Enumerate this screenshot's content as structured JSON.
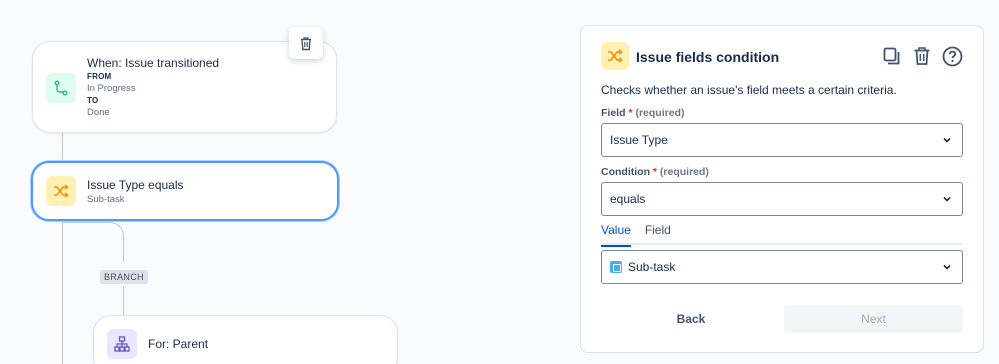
{
  "flow": {
    "trigger": {
      "title": "When: Issue transitioned",
      "from_label": "FROM",
      "from_value": "In Progress",
      "to_label": "TO",
      "to_value": "Done"
    },
    "condition": {
      "title": "Issue Type equals",
      "subtitle": "Sub-task"
    },
    "branch_label": "BRANCH",
    "branch_node": {
      "title": "For: Parent"
    }
  },
  "panel": {
    "title": "Issue fields condition",
    "description": "Checks whether an issue's field meets a certain criteria.",
    "field": {
      "label": "Field",
      "required_mark": "*",
      "required_text": "(required)",
      "value": "Issue Type"
    },
    "condition": {
      "label": "Condition",
      "required_mark": "*",
      "required_text": "(required)",
      "value": "equals"
    },
    "tabs": [
      {
        "label": "Value",
        "active": true
      },
      {
        "label": "Field",
        "active": false
      }
    ],
    "value_select": {
      "value": "Sub-task"
    },
    "buttons": {
      "back": "Back",
      "next": "Next"
    }
  },
  "colors": {
    "accent": "#0052cc",
    "selected_border": "#4c9aff",
    "trigger_icon": "#36b37e",
    "condition_icon": "#ff8b00",
    "branch_icon": "#6554c0",
    "required": "#de350b"
  }
}
